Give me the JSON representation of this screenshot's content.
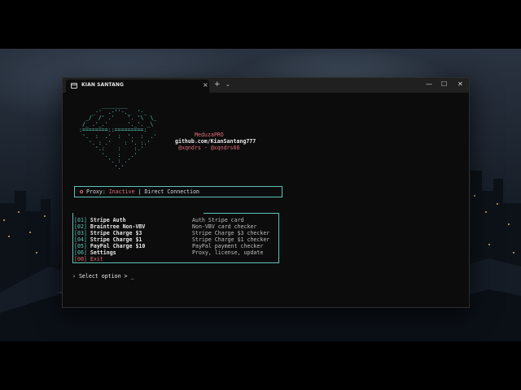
{
  "window": {
    "tab_title": "KIAN SANTANG",
    "tab_close": "×",
    "new_tab": "+",
    "tab_dropdown": "⌄",
    "minimize": "—",
    "maximize": "☐",
    "close": "✕"
  },
  "banner": {
    "ascii_art": "       ________\n    _-'  .-''-._  '-_\n  _/  /' .'    '. '\\  \\_\n /_ .'_.'      '._'. _\\\n:========::=========:\n '.  :  .'  :  '.  :  .'\n   '. : .'    : '. :.'\n     '.:    :    :.'\n       '.   :   .'\n         '. : .'\n           '.'",
    "brand": "MeduzaPRO",
    "github": "github.com/KianSantang777",
    "handles": "@xqndrs - @xqndrs66"
  },
  "proxy": {
    "label": "Proxy:",
    "status": "Inactive",
    "separator": "|",
    "mode": "Direct Connection"
  },
  "menu": [
    {
      "key": "[01]",
      "label": "Stripe Auth",
      "desc": "Auth Stripe card"
    },
    {
      "key": "[02]",
      "label": "Braintree Non-VBV",
      "desc": "Non-VBV card checker"
    },
    {
      "key": "[03]",
      "label": "Stripe Charge $3",
      "desc": "Stripe Charge $3 checker"
    },
    {
      "key": "[04]",
      "label": "Stripe Charge $1",
      "desc": "Stripe Charge $1 checker"
    },
    {
      "key": "[05]",
      "label": "PayPal Charge $10",
      "desc": "PayPal payment checker"
    },
    {
      "key": "[06]",
      "label": "Settings",
      "desc": "Proxy, license, update"
    },
    {
      "key": "[00]",
      "label": "Exit",
      "desc": ""
    }
  ],
  "prompt": {
    "text": "› Select option > _"
  },
  "colors": {
    "teal": "#5fc4b8",
    "red": "#e06c75",
    "background": "#0c0c0c"
  }
}
